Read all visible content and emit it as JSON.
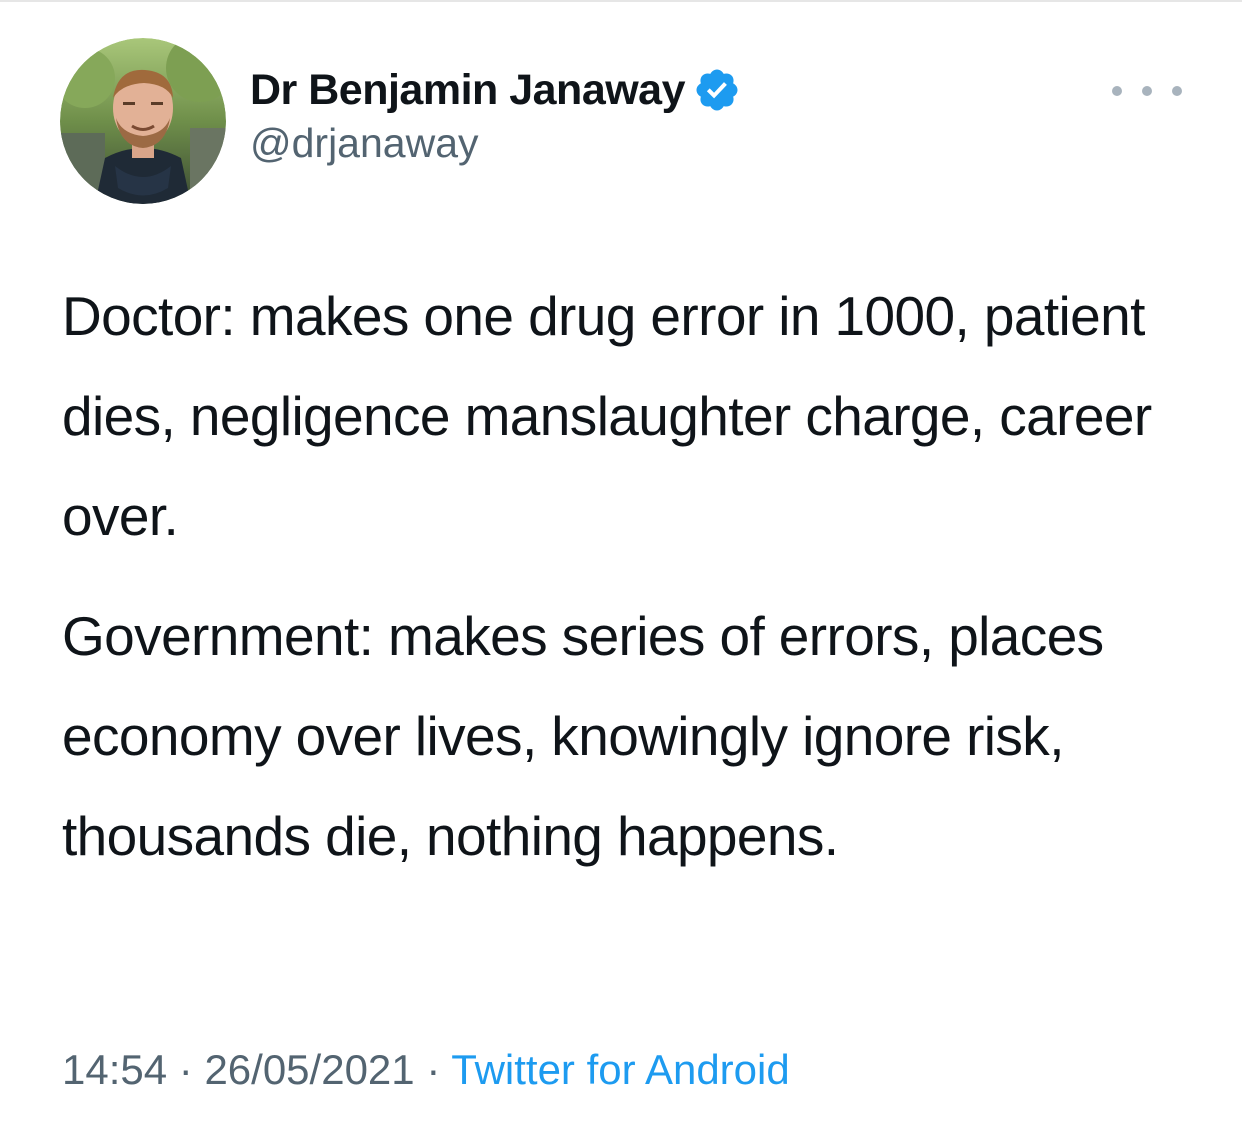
{
  "tweet": {
    "author": {
      "display_name": "Dr Benjamin Janaway",
      "handle": "@drjanaway",
      "verified": true,
      "avatar_icon": "profile-photo"
    },
    "more_icon": "ellipsis-icon",
    "paragraphs": [
      "Doctor: makes one drug error in 1000, patient dies, negligence manslaughter charge, career over.",
      "Government: makes series of errors, places economy over lives, knowingly ignore risk, thousands die, nothing happens."
    ],
    "meta": {
      "time": "14:54",
      "separator_1": " · ",
      "date": "26/05/2021",
      "separator_2": " · ",
      "source": "Twitter for Android"
    }
  },
  "colors": {
    "text": "#0f1419",
    "secondary": "#536471",
    "accent": "#1d9bf0",
    "verified": "#1d9bf0"
  }
}
